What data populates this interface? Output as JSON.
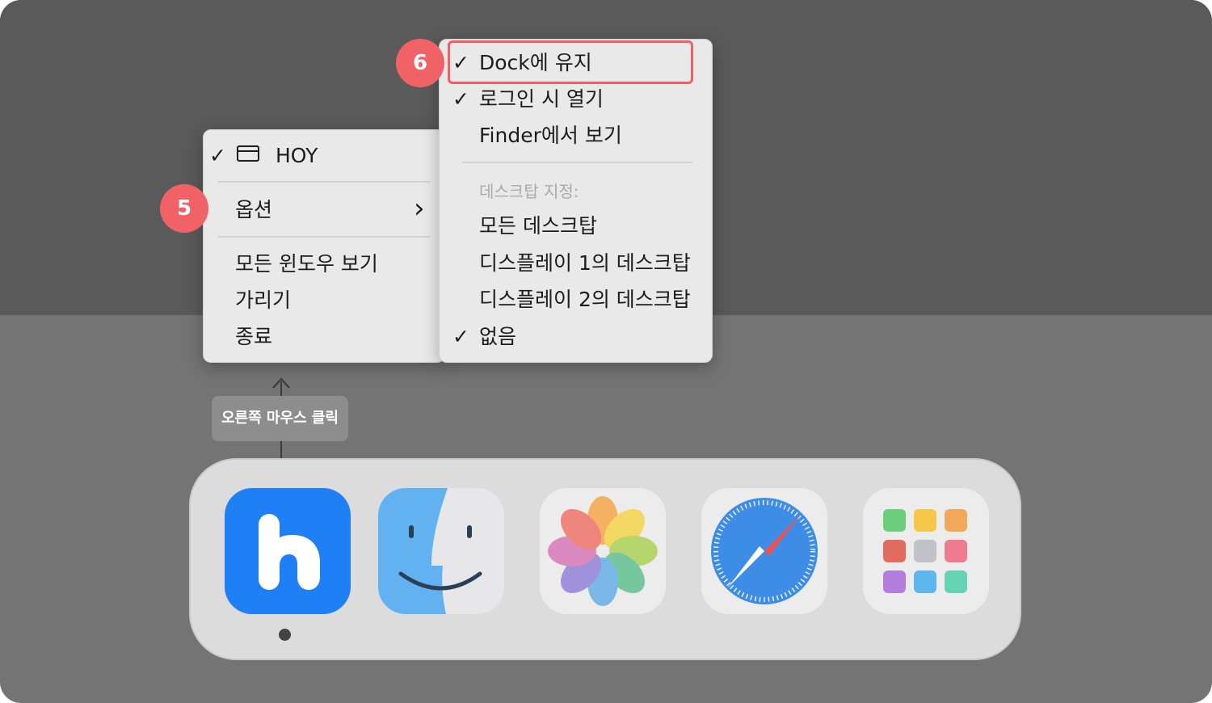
{
  "context_menu": {
    "app_item_label": "HOY",
    "options_label": "옵션",
    "show_all_windows_label": "모든 윈도우 보기",
    "hide_label": "가리기",
    "quit_label": "종료",
    "check_glyph": "✓",
    "submenu_arrow_glyph": "›"
  },
  "options_submenu": {
    "keep_in_dock_label": "Dock에 유지",
    "open_at_login_label": "로그인 시 열기",
    "show_in_finder_label": "Finder에서 보기",
    "assign_desktop_heading": "데스크탑 지정:",
    "all_desktops_label": "모든 데스크탑",
    "display1_desktop_label": "디스플레이 1의 데스크탑",
    "display2_desktop_label": "디스플레이 2의 데스크탑",
    "none_label": "없음"
  },
  "annotations": {
    "step5": "5",
    "step6": "6",
    "tooltip_label": "오른쪽 마우스 클릭"
  },
  "dock": {
    "apps": [
      "hoy-app-icon",
      "finder-icon",
      "photos-icon",
      "safari-icon",
      "launchpad-icon"
    ]
  },
  "colors": {
    "accent_red": "#f06266",
    "hoy_blue": "#1f7ff5",
    "menu_bg": "#e9e9e9"
  }
}
